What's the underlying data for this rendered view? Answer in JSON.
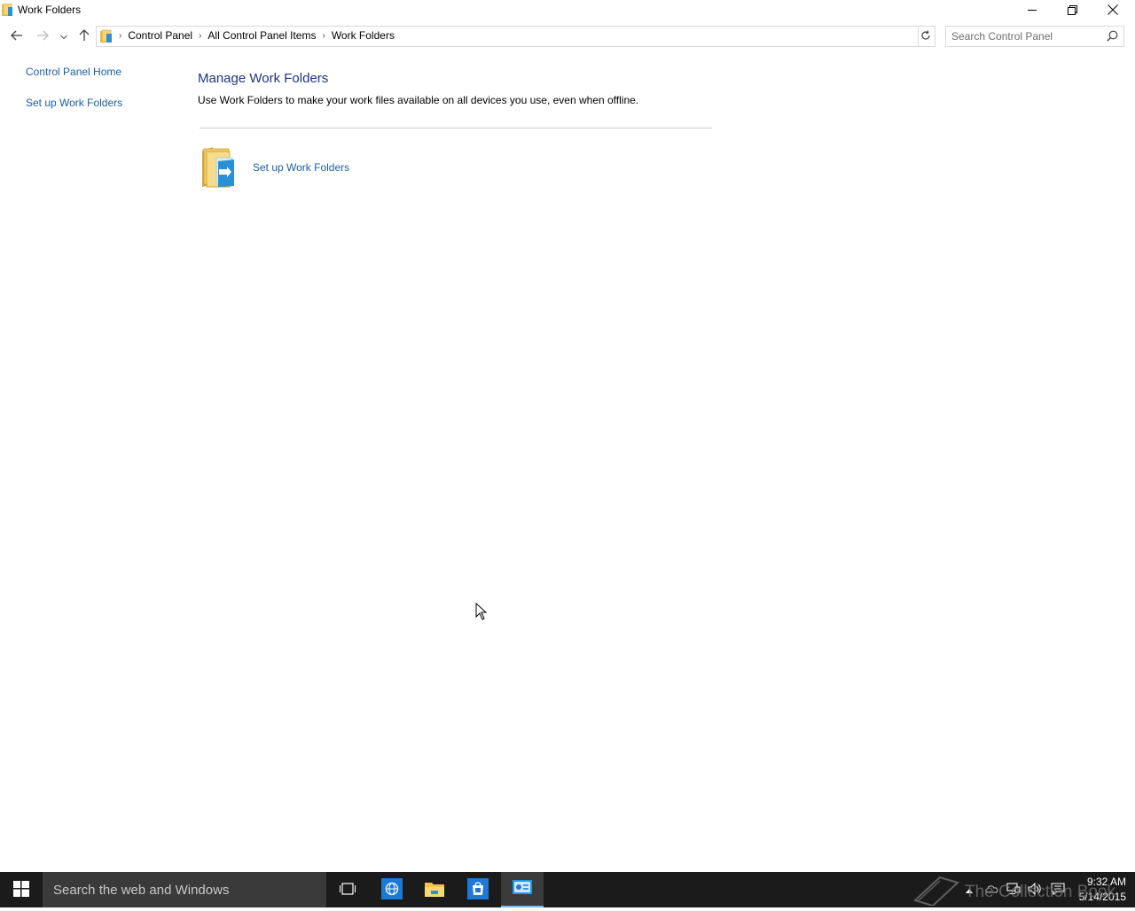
{
  "window": {
    "title": "Work Folders",
    "buttons": {
      "minimize": "minimize-icon",
      "restore": "restore-icon",
      "close": "close-icon"
    }
  },
  "nav": {
    "breadcrumbs": [
      "Control Panel",
      "All Control Panel Items",
      "Work Folders"
    ],
    "search_placeholder": "Search Control Panel"
  },
  "sidebar": {
    "items": [
      {
        "label": "Control Panel Home"
      },
      {
        "label": "Set up Work Folders"
      }
    ]
  },
  "main": {
    "heading": "Manage Work Folders",
    "description": "Use Work Folders to make your work files available on all devices you use, even when offline.",
    "task_label": "Set up Work Folders"
  },
  "taskbar": {
    "search_placeholder": "Search the web and Windows",
    "clock_time": "9:32 AM",
    "clock_date": "5/14/2015",
    "watermark": "The Collection Book",
    "accent": "#76b9ed"
  },
  "colors": {
    "link": "#1a5ea8",
    "heading": "#1e3287",
    "taskbar": "#1b1b1b"
  }
}
